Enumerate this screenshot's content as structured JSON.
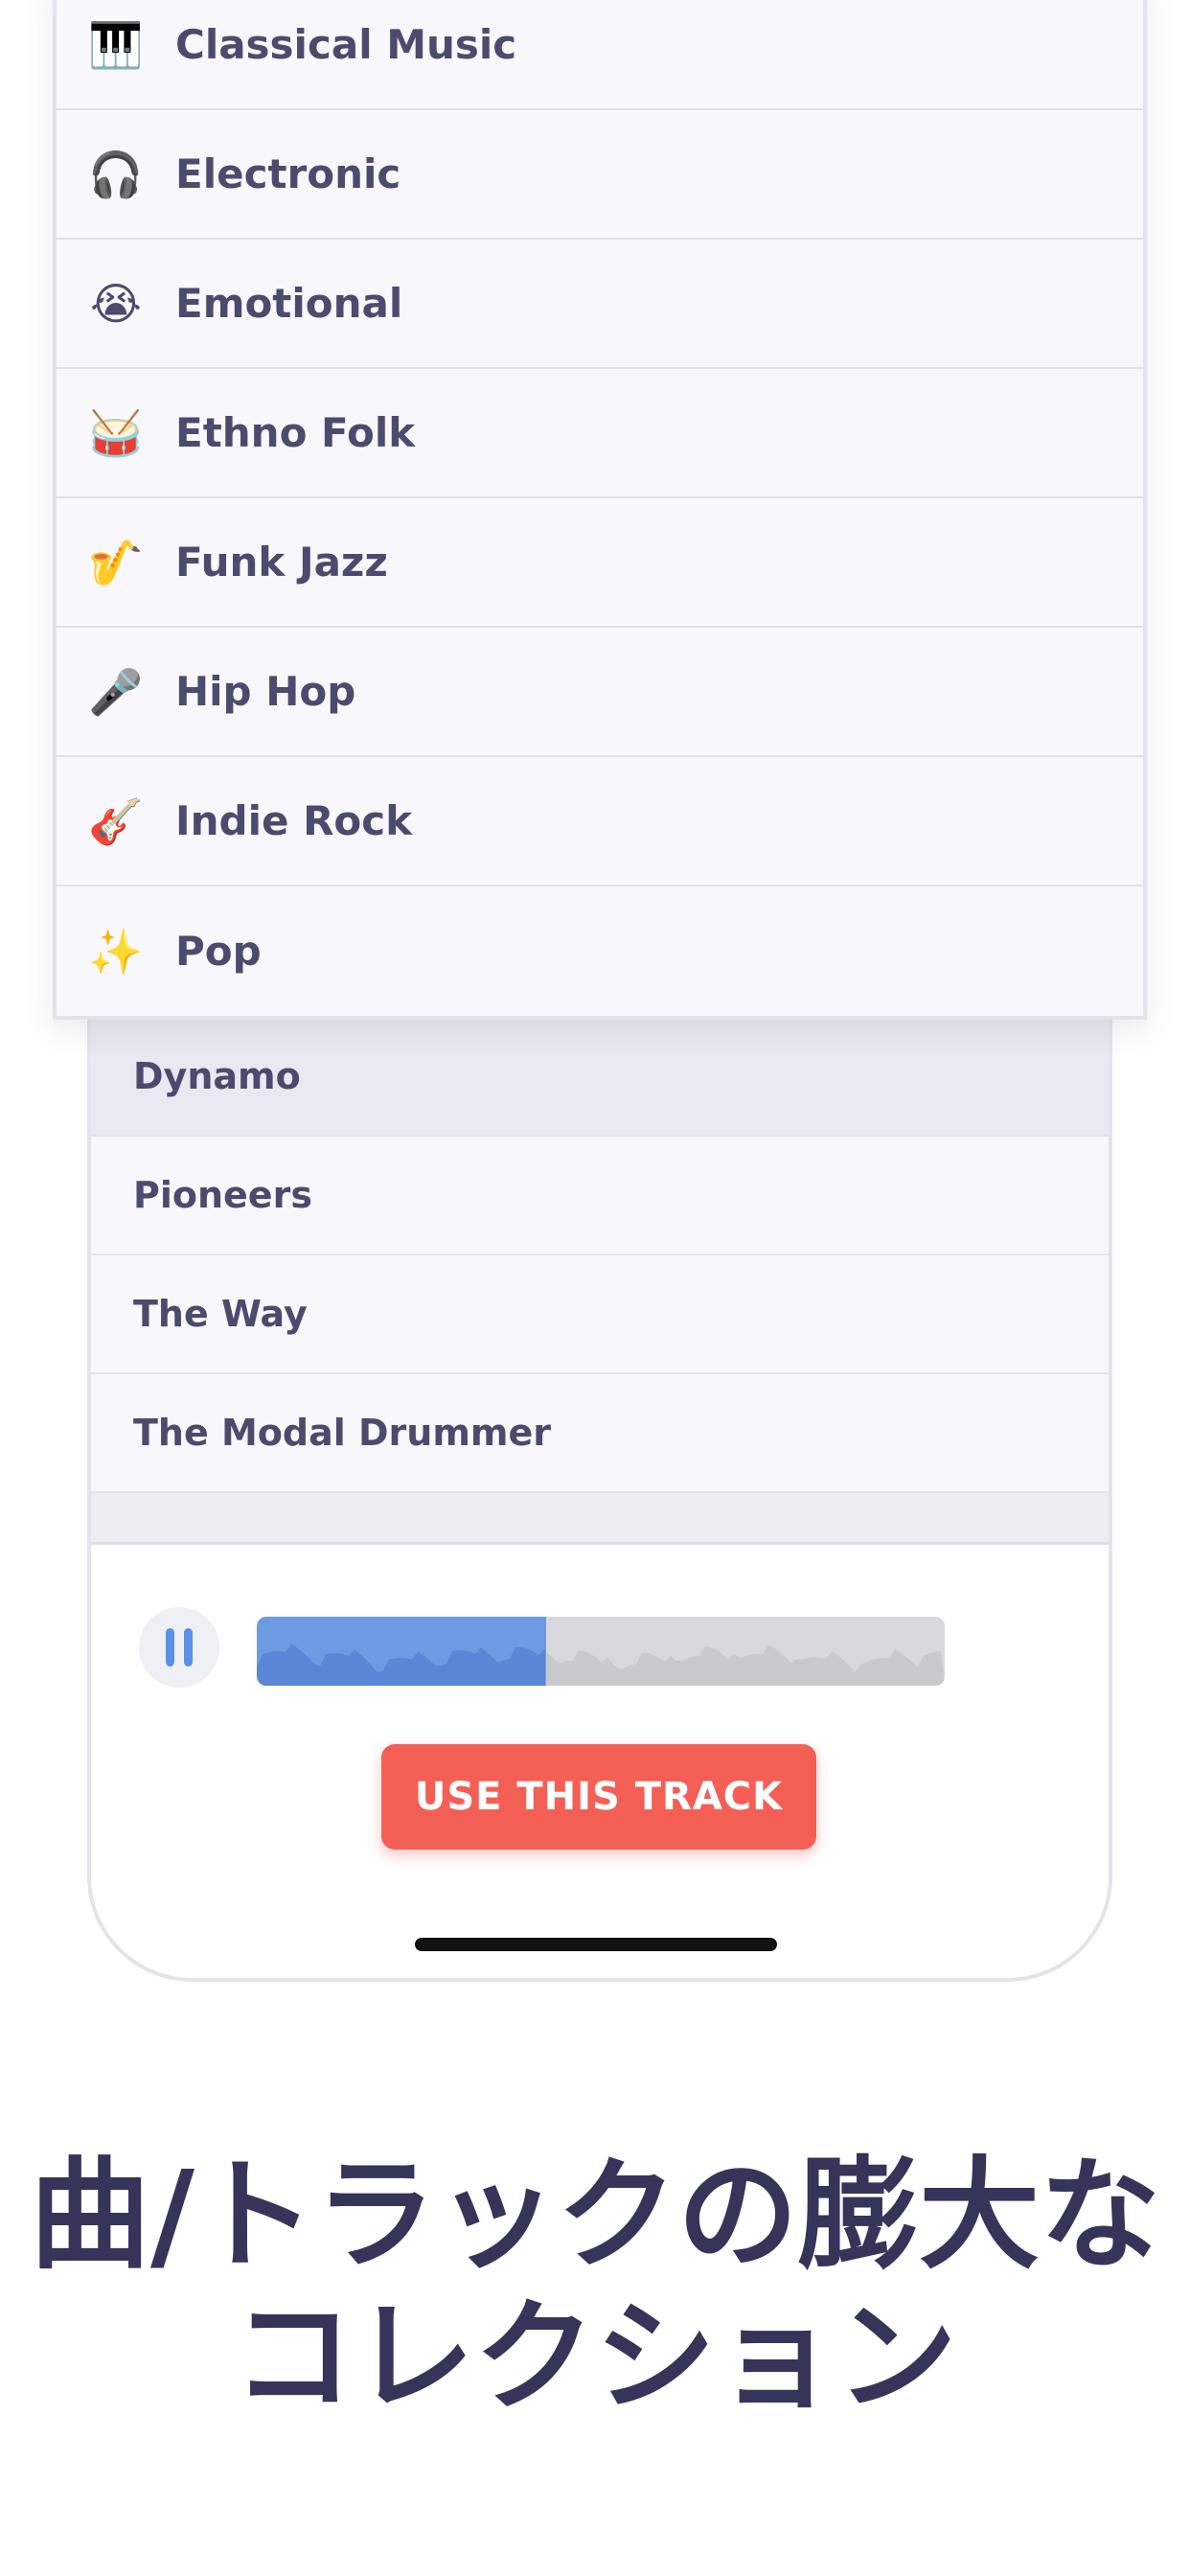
{
  "genres": [
    {
      "label": "Classical Music",
      "icon": "🎹"
    },
    {
      "label": "Electronic",
      "icon": "🎧"
    },
    {
      "label": "Emotional",
      "icon": "😭"
    },
    {
      "label": "Ethno Folk",
      "icon": "🥁"
    },
    {
      "label": "Funk Jazz",
      "icon": "🎷"
    },
    {
      "label": "Hip Hop",
      "icon": "🎤"
    },
    {
      "label": "Indie Rock",
      "icon": "🎸"
    },
    {
      "label": "Pop",
      "icon": "✨"
    }
  ],
  "tracks": [
    {
      "label": "Dynamo",
      "selected": true
    },
    {
      "label": "Pioneers"
    },
    {
      "label": "The Way"
    },
    {
      "label": "The Modal Drummer"
    }
  ],
  "player": {
    "state": "playing",
    "progress": 0.42,
    "use_track_label": "USE THIS TRACK"
  },
  "caption": {
    "line1": "曲/トラックの膨大な",
    "line2": "コレクション"
  },
  "colors": {
    "accent": "#f45f55",
    "progress": "#6e9ae2",
    "text": "#4b4b6e",
    "caption": "#35355a"
  }
}
